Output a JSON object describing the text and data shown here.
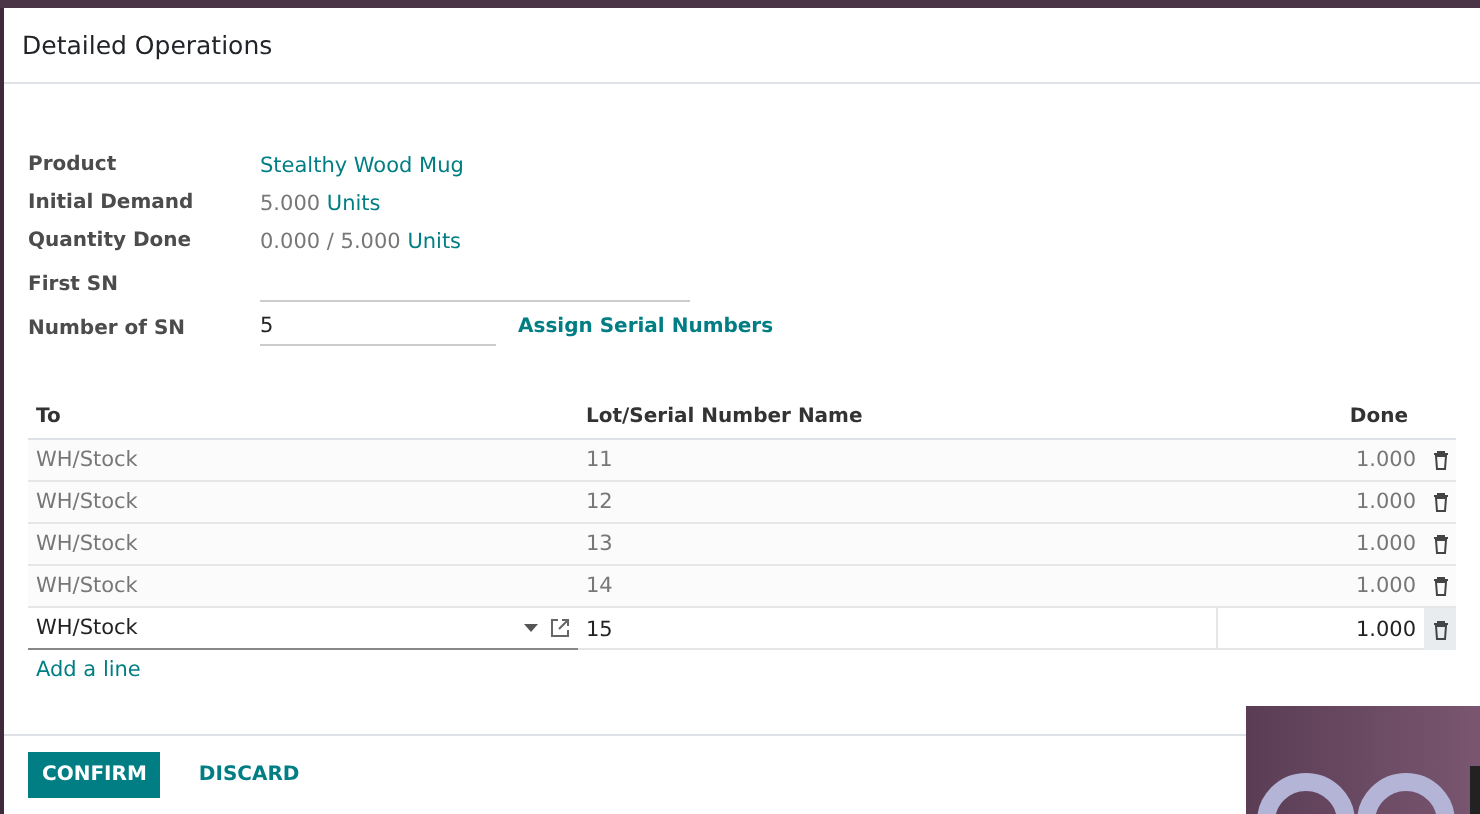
{
  "dialog": {
    "title": "Detailed Operations"
  },
  "fields": [
    {
      "kind": "link",
      "label": "Product",
      "value": "Stealthy Wood Mug"
    },
    {
      "kind": "qty",
      "label": "Initial Demand",
      "value": "5.000",
      "unit": "Units"
    },
    {
      "kind": "qty",
      "label": "Quantity Done",
      "value": "0.000 / 5.000",
      "unit": "Units"
    },
    {
      "kind": "input",
      "label": "First SN"
    },
    {
      "kind": "input",
      "label": "Number of SN",
      "value": "5",
      "action": "Assign Serial Numbers"
    }
  ],
  "table": {
    "columns": [
      "To",
      "Lot/Serial Number Name",
      "Done"
    ],
    "rows": [
      {
        "to": "WH/Stock",
        "lot": "11",
        "done": "1.000",
        "editing": false
      },
      {
        "to": "WH/Stock",
        "lot": "12",
        "done": "1.000",
        "editing": false
      },
      {
        "to": "WH/Stock",
        "lot": "13",
        "done": "1.000",
        "editing": false
      },
      {
        "to": "WH/Stock",
        "lot": "14",
        "done": "1.000",
        "editing": false
      },
      {
        "to": "WH/Stock",
        "lot": "15",
        "done": "1.000",
        "editing": true
      }
    ],
    "add_line": "Add a line"
  },
  "buttons": [
    {
      "kind": "primary",
      "label": "CONFIRM"
    },
    {
      "kind": "link",
      "label": "DISCARD"
    }
  ]
}
